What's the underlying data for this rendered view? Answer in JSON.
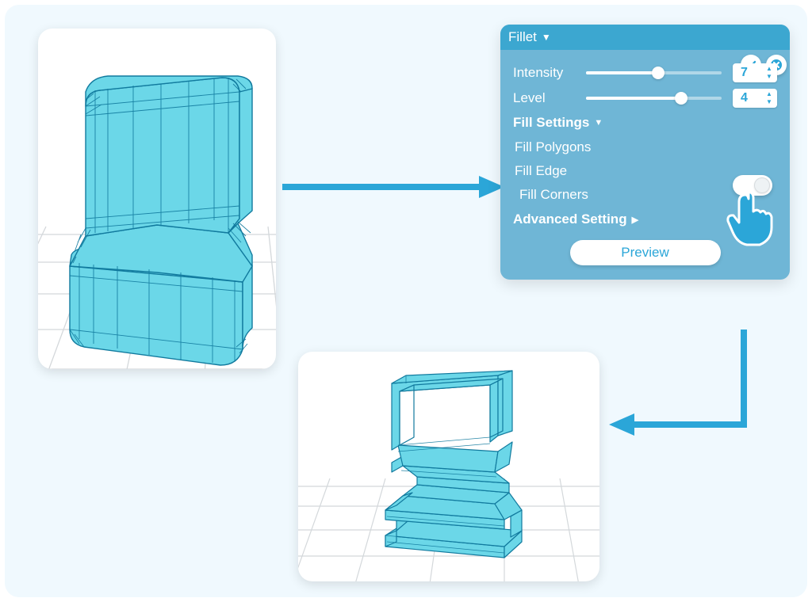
{
  "panel": {
    "title": "Fillet",
    "intensity": {
      "label": "Intensity",
      "value": 7,
      "pct": 53
    },
    "level": {
      "label": "Level",
      "value": 4,
      "pct": 70
    },
    "fill_settings_label": "Fill Settings",
    "fill_polygons_label": "Fill Polygons",
    "fill_edge_label": "Fill Edge",
    "fill_corners_label": "Fill Corners",
    "advanced_label": "Advanced Setting",
    "preview_label": "Preview",
    "fill_edge_toggle": true
  },
  "colors": {
    "accent": "#2ba6d8",
    "panel": "#6fb6d6",
    "mesh": "#117a9e",
    "fill": "#6bd7e8"
  }
}
